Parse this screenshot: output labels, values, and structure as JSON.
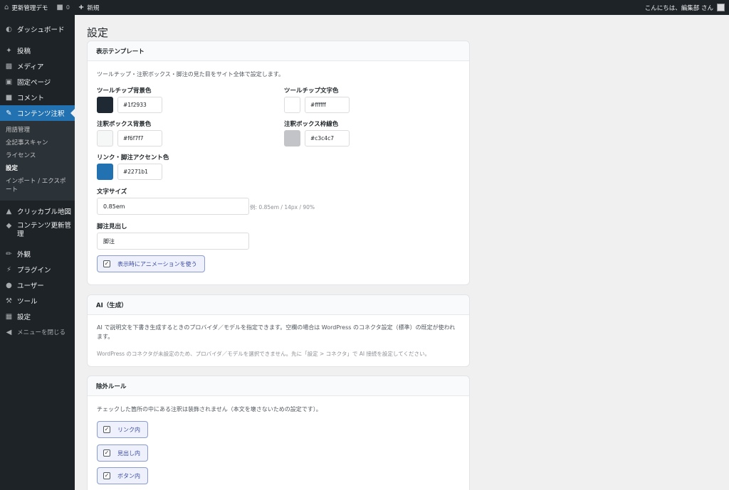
{
  "adminbar": {
    "site_name": "更新管理デモ",
    "comments_count": "0",
    "new_label": "新規",
    "greeting": "こんにちは、編集部 さん"
  },
  "sidebar": {
    "items": [
      {
        "label": "ダッシュボード",
        "icon": "dashboard-icon"
      },
      {
        "label": "投稿",
        "icon": "pin-icon"
      },
      {
        "label": "メディア",
        "icon": "media-icon"
      },
      {
        "label": "固定ページ",
        "icon": "page-icon"
      },
      {
        "label": "コメント",
        "icon": "comment-icon"
      },
      {
        "label": "コンテンツ注釈",
        "icon": "pencil-icon"
      }
    ],
    "submenu": [
      "用語管理",
      "全記事スキャン",
      "ライセンス",
      "設定",
      "インポート / エクスポート"
    ],
    "items_after": [
      {
        "label": "クリッカブル地図",
        "icon": "map-icon"
      },
      {
        "label": "コンテンツ更新管理",
        "icon": "tag-icon"
      },
      {
        "label": "外観",
        "icon": "brush-icon"
      },
      {
        "label": "プラグイン",
        "icon": "plugin-icon"
      },
      {
        "label": "ユーザー",
        "icon": "user-icon"
      },
      {
        "label": "ツール",
        "icon": "wrench-icon"
      },
      {
        "label": "設定",
        "icon": "settings-icon"
      },
      {
        "label": "メニューを閉じる",
        "icon": "collapse-icon"
      }
    ]
  },
  "page": {
    "title": "設定"
  },
  "template_card": {
    "heading": "表示テンプレート",
    "description": "ツールチップ・注釈ボックス・脚注の見た目をサイト全体で設定します。",
    "colors": [
      {
        "label": "ツールチップ背景色",
        "value": "#1f2933",
        "swatch": "#1f2933"
      },
      {
        "label": "ツールチップ文字色",
        "value": "#ffffff",
        "swatch": "#ffffff"
      },
      {
        "label": "注釈ボックス背景色",
        "value": "#f6f7f7",
        "swatch": "#f6f7f7"
      },
      {
        "label": "注釈ボックス枠線色",
        "value": "#c3c4c7",
        "swatch": "#c3c4c7"
      },
      {
        "label": "リンク・脚注アクセント色",
        "value": "#2271b1",
        "swatch": "#2271b1"
      }
    ],
    "font_size_label": "文字サイズ",
    "font_size_value": "0.85em",
    "font_size_hint": "例: 0.85em / 14px / 90%",
    "footnote_heading_label": "脚注見出し",
    "footnote_heading_value": "脚注",
    "animation_label": "表示時にアニメーションを使う",
    "animation_checked": true
  },
  "ai_card": {
    "heading": "AI（生成）",
    "description": "AI で説明文を下書き生成するときのプロバイダ／モデルを指定できます。空欄の場合は WordPress のコネクタ設定（標準）の既定が使われます。",
    "note": "WordPress のコネクタが未設定のため、プロバイダ／モデルを選択できません。先に「設定 > コネクタ」で AI 接続を設定してください。"
  },
  "exclude_card": {
    "heading": "除外ルール",
    "description": "チェックした箇所の中にある注釈は装飾されません（本文を壊さないための設定です）。",
    "options": [
      {
        "label": "リンク内",
        "checked": true
      },
      {
        "label": "見出し内",
        "checked": true
      },
      {
        "label": "ボタン内",
        "checked": true
      }
    ]
  }
}
